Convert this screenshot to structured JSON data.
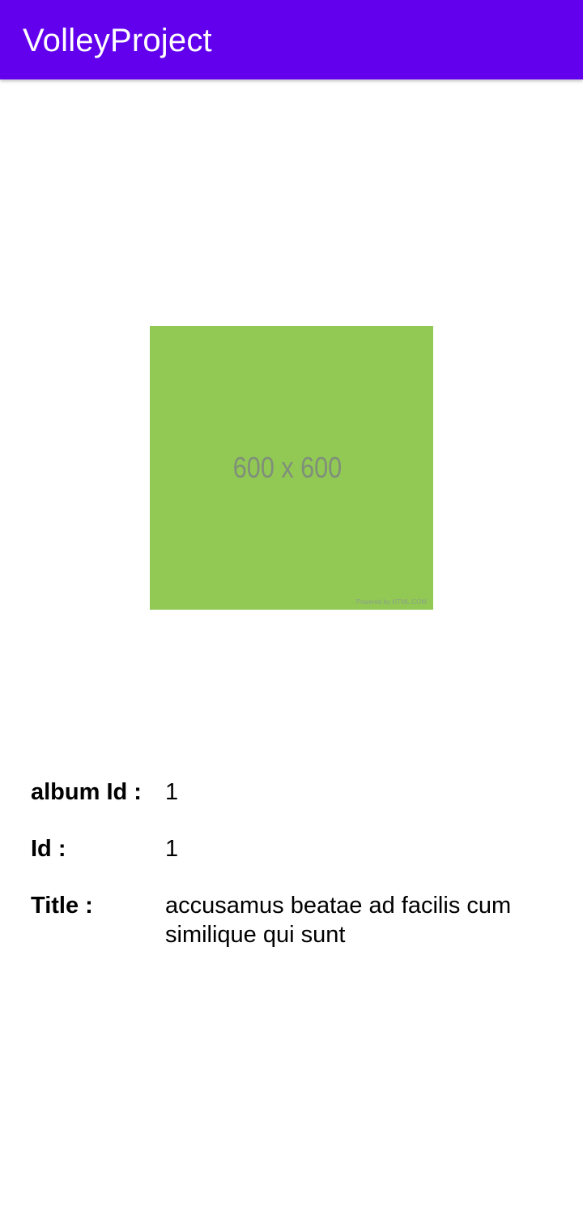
{
  "app_bar": {
    "title": "VolleyProject",
    "color": "#6200ee"
  },
  "photo": {
    "placeholder_text": "600 x 600",
    "credit_text": "Powered by HTML.COM",
    "background_color": "#92c954"
  },
  "details": {
    "album_id": {
      "label": "album Id :",
      "value": "1"
    },
    "id": {
      "label": "Id :",
      "value": "1"
    },
    "title": {
      "label": "Title :",
      "value": "accusamus beatae ad facilis cum similique qui sunt"
    }
  }
}
